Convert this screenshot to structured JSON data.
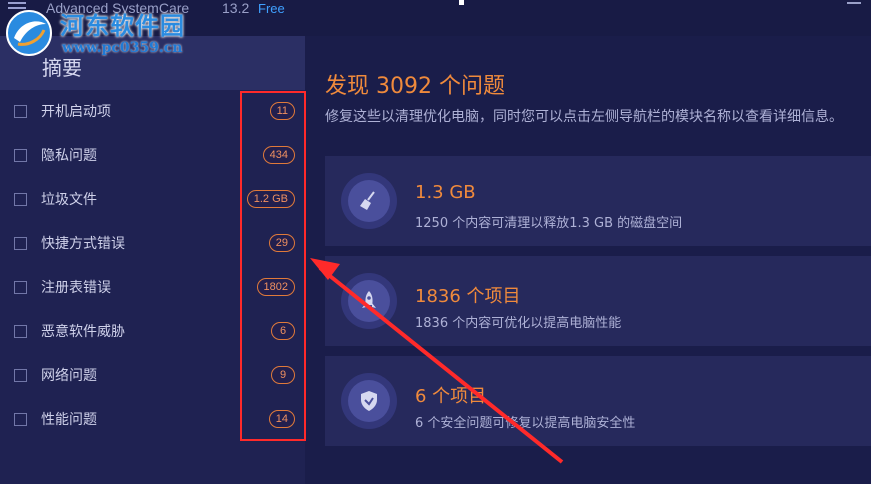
{
  "window": {
    "app_name": "Advanced SystemCare",
    "version": "13.2",
    "edition": "Free"
  },
  "watermark": {
    "title": "河东软件园",
    "url": "www.pc0359.cn"
  },
  "sidebar": {
    "summary_label": "摘要",
    "items": [
      {
        "label": "开机启动项",
        "count": "11"
      },
      {
        "label": "隐私问题",
        "count": "434"
      },
      {
        "label": "垃圾文件",
        "count": "1.2 GB"
      },
      {
        "label": "快捷方式错误",
        "count": "29"
      },
      {
        "label": "注册表错误",
        "count": "1802"
      },
      {
        "label": "恶意软件威胁",
        "count": "6"
      },
      {
        "label": "网络问题",
        "count": "9"
      },
      {
        "label": "性能问题",
        "count": "14"
      }
    ]
  },
  "main": {
    "headline": "发现 3092 个问题",
    "subtext": "修复这些以清理优化电脑，同时您可以点击左侧导航栏的模块名称以查看详细信息。",
    "cards": [
      {
        "icon": "broom-icon",
        "title": "1.3 GB",
        "desc": "1250 个内容可清理以释放1.3 GB 的磁盘空间"
      },
      {
        "icon": "rocket-icon",
        "title": "1836 个项目",
        "desc": "1836 个内容可优化以提高电脑性能"
      },
      {
        "icon": "shield-icon",
        "title": "6 个项目",
        "desc": "6 个安全问题可修复以提高电脑安全性"
      }
    ]
  },
  "colors": {
    "accent": "#f08a3c",
    "annotation": "#ff2a2a",
    "background": "#1a1d4a"
  }
}
